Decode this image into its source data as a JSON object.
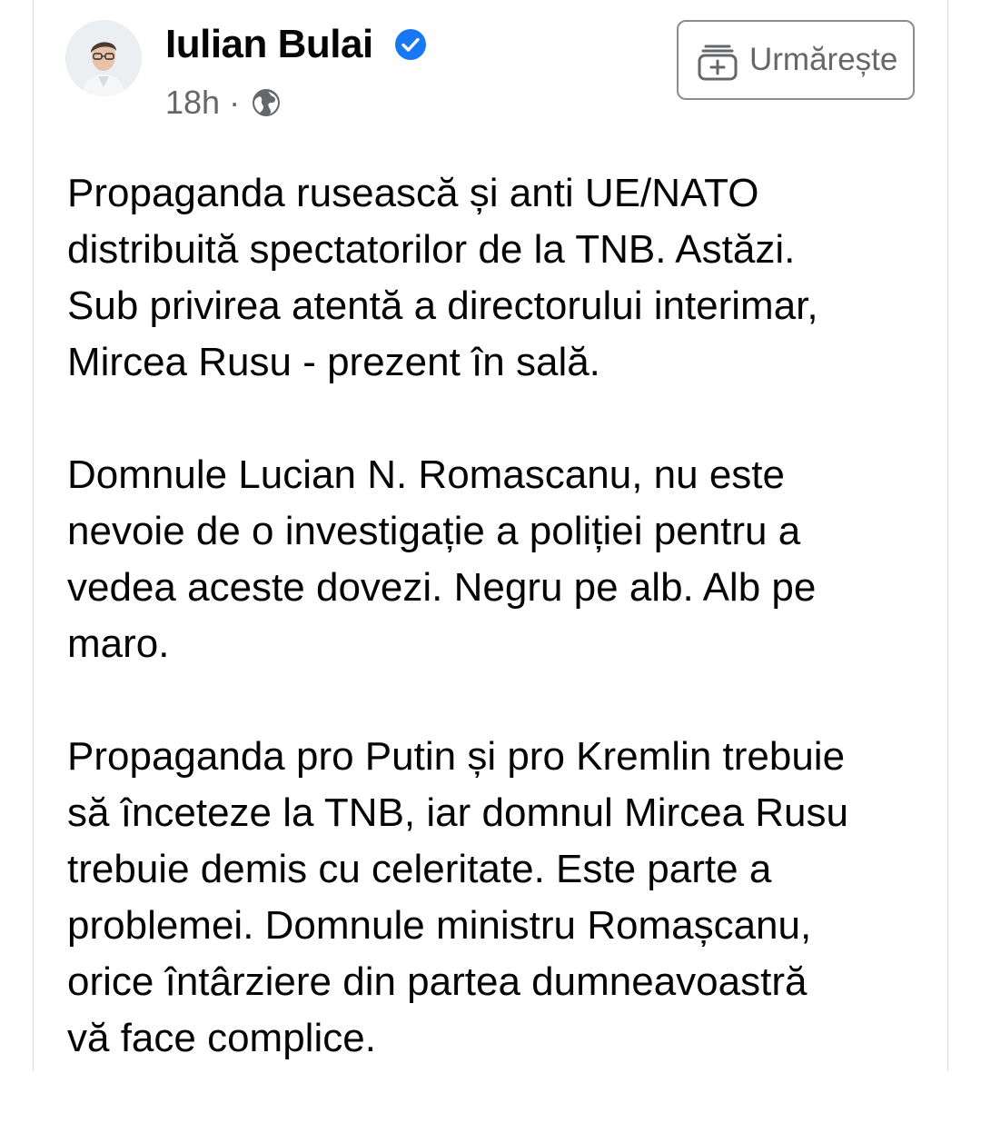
{
  "post": {
    "author": {
      "name": "Iulian Bulai",
      "verified": true,
      "avatar_icon": "user-avatar-photo"
    },
    "timestamp": "18h",
    "separator": "·",
    "privacy_icon": "globe-icon",
    "follow_button": {
      "label": "Urmărește",
      "icon": "follow-add-icon"
    },
    "paragraphs": [
      "Propaganda rusească și anti UE/NATO\ndistribuită spectatorilor de la TNB. Astăzi.\nSub privirea atentă a directorului interimar,\nMircea Rusu - prezent în sală.",
      "Domnule Lucian N. Romascanu, nu este\nnevoie de o investigație a poliției pentru a\nvedea aceste dovezi. Negru pe alb. Alb pe\nmaro.",
      "Propaganda pro Putin și pro Kremlin trebuie\nsă înceteze la TNB, iar domnul Mircea Rusu\ntrebuie demis cu celeritate. Este parte a\nproblemei. Domnule ministru Romașcanu,\norice întârziere din partea dumneavoastră\nvă face complice."
    ]
  },
  "colors": {
    "text_primary": "#050505",
    "text_secondary": "#65676b",
    "verified_blue": "#1877f2",
    "border": "#8a8d91"
  }
}
